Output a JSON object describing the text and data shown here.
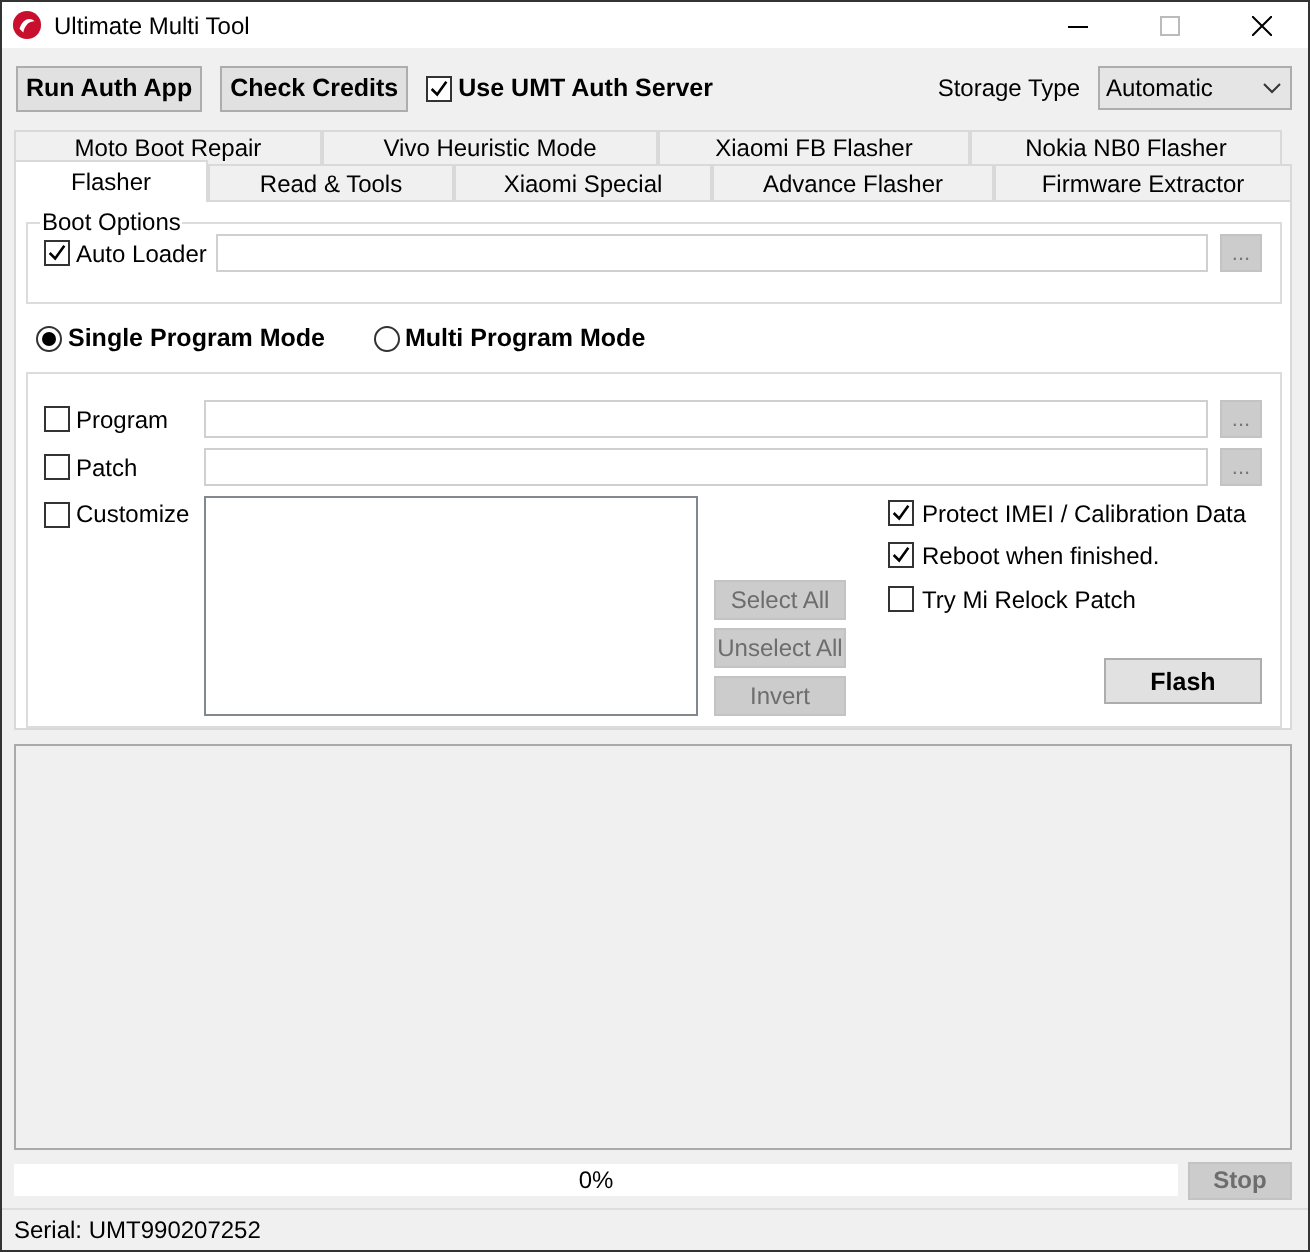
{
  "window": {
    "title": "Ultimate Multi Tool"
  },
  "toolbar": {
    "buttons": [
      "Run Auth App",
      "Check Credits"
    ],
    "auth_server": {
      "label": "Use UMT Auth Server",
      "checked": true
    },
    "storage_type": {
      "label": "Storage Type",
      "value": "Automatic"
    }
  },
  "tabs": {
    "row_1": [
      {
        "label": "Moto Boot Repair",
        "selected": false
      },
      {
        "label": "Vivo Heuristic Mode",
        "selected": false
      },
      {
        "label": "Xiaomi FB Flasher",
        "selected": false
      },
      {
        "label": "Nokia NB0 Flasher",
        "selected": false
      }
    ],
    "row_2": [
      {
        "label": "Flasher",
        "selected": true
      },
      {
        "label": "Read & Tools",
        "selected": false
      },
      {
        "label": "Xiaomi Special",
        "selected": false
      },
      {
        "label": "Advance Flasher",
        "selected": false
      },
      {
        "label": "Firmware Extractor",
        "selected": false
      }
    ]
  },
  "boot_options": {
    "title": "Boot Options",
    "auto_loader": {
      "label": "Auto Loader",
      "checked": true
    },
    "browse": "..."
  },
  "modes": [
    {
      "label": "Single Program Mode",
      "selected": true
    },
    {
      "label": "Multi Program Mode",
      "selected": false
    }
  ],
  "files": [
    {
      "label": "Program",
      "checked": false,
      "browse": "..."
    },
    {
      "label": "Patch",
      "checked": false,
      "browse": "..."
    }
  ],
  "customize": {
    "label": "Customize",
    "checked": false
  },
  "list_buttons": [
    {
      "label": "Select All",
      "disabled": true
    },
    {
      "label": "Unselect All",
      "disabled": true
    },
    {
      "label": "Invert",
      "disabled": true
    }
  ],
  "options": [
    {
      "label": "Protect IMEI / Calibration Data",
      "checked": true
    },
    {
      "label": "Reboot when finished.",
      "checked": true
    },
    {
      "label": "Try Mi Relock Patch",
      "checked": false
    }
  ],
  "flash_button": "Flash",
  "progress": {
    "level": 0,
    "label": "0%"
  },
  "stop_button": {
    "label": "Stop",
    "disabled": true
  },
  "status_bar": {
    "serial": "Serial: UMT990207252"
  }
}
